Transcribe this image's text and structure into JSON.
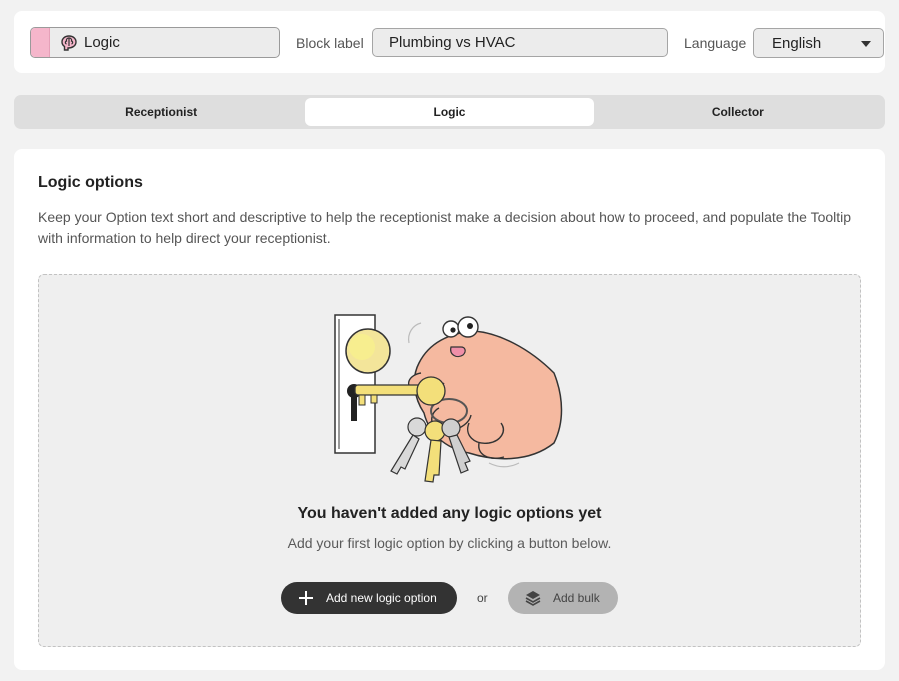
{
  "header": {
    "block_type": {
      "label": "Logic",
      "icon": "brain-icon",
      "accent": "#f5b6cb"
    },
    "block_label": {
      "label": "Block label",
      "value": "Plumbing vs HVAC"
    },
    "language": {
      "label": "Language",
      "selected": "English"
    }
  },
  "tabs": [
    {
      "label": "Receptionist",
      "active": false
    },
    {
      "label": "Logic",
      "active": true
    },
    {
      "label": "Collector",
      "active": false
    }
  ],
  "main": {
    "title": "Logic options",
    "description": "Keep your Option text short and descriptive to help the receptionist make a decision about how to proceed, and populate the Tooltip with information to help direct your receptionist.",
    "empty_state": {
      "illustration": "hand-holding-keys-illustration",
      "title": "You haven't added any logic options yet",
      "subtitle": "Add your first logic option by clicking a button below.",
      "primary_button": "Add new logic option",
      "or": "or",
      "secondary_button": "Add bulk"
    }
  },
  "colors": {
    "primary_button": "#333333",
    "secondary_button": "#b3b3b3",
    "accent_pink": "#f5b6cb"
  }
}
